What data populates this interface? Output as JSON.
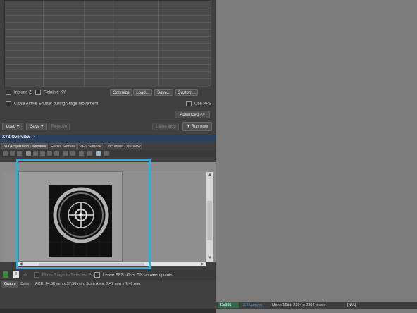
{
  "options": {
    "include_z": "Include Z",
    "relative_xy": "Relative XY",
    "close_shutter": "Close Active Shutter during Stage Movement",
    "use_pfs": "Use PFS"
  },
  "buttons": {
    "optimize": "Optimize",
    "load_dots": "Load...",
    "save_dots": "Save...",
    "custom_dots": "Custom...",
    "advanced": "Advanced >>",
    "load": "Load",
    "save": "Save",
    "remove": "Remove",
    "one_time_loop": "1 time loop",
    "run_now": "Run now"
  },
  "panel": {
    "title": "XYZ Overview",
    "close": "×",
    "tabs": [
      "ND Acquisition Overview",
      "Focus Surface",
      "PFS Surface",
      "Document Overview"
    ]
  },
  "bottom": {
    "move_stage": "Move Stage to Selected Point",
    "leave_pfs": "Leave PFS offset ON between points",
    "info": "ACE: 34.58 mm x 37.50 mm, Scan Area: 7.49 mm x 7.49 mm",
    "graph_tab": "Graph",
    "data_tab": "Data"
  },
  "status": {
    "channel": "Ex395",
    "scale": "3.25 µm/px",
    "image_info": "Mono 16bit: 2304 x 2304 pixels",
    "na": "[N/A]"
  },
  "colors": {
    "accent": "#2ab0e0",
    "panel_bg": "#3f3f3f",
    "header_bg": "#27415e"
  }
}
